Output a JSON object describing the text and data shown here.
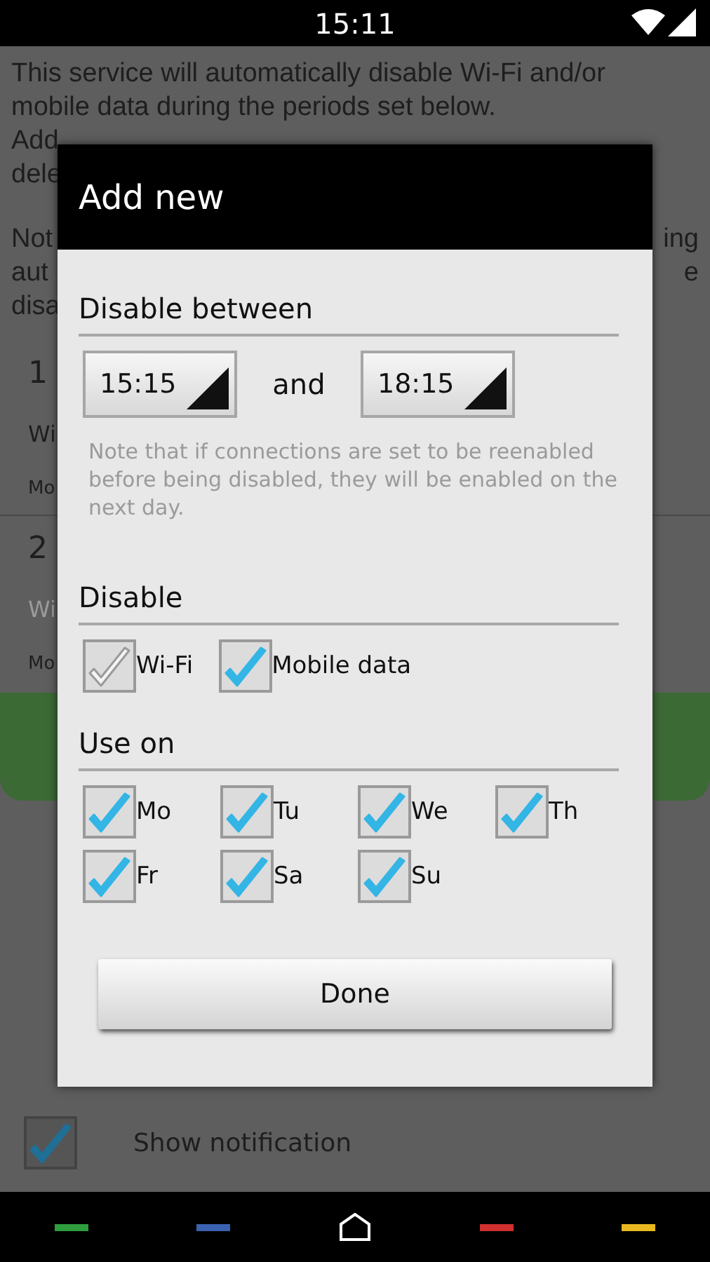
{
  "status_bar": {
    "time": "15:11"
  },
  "background": {
    "intro_lines": [
      {
        "left": "This service will automatically disable Wi-Fi and/or"
      },
      {
        "left": "mobile data during the periods set below."
      },
      {
        "left": "Add"
      },
      {
        "left": "dele"
      },
      {
        "left": "Not",
        "right": "ing"
      },
      {
        "left": "aut",
        "right": "e"
      },
      {
        "left": "disa"
      }
    ],
    "periods": [
      {
        "time": "1",
        "wifi": "Wi",
        "wifi_disabled": false,
        "days": "Mo"
      },
      {
        "time": "2",
        "wifi": "Wi",
        "wifi_disabled": true,
        "days": "Mo"
      }
    ],
    "show_notification": {
      "label": "Show notification",
      "checked": true
    }
  },
  "dialog": {
    "title": "Add new",
    "disable_between": {
      "heading": "Disable between",
      "from": "15:15",
      "joiner": "and",
      "to": "18:15",
      "note": "Note that if connections are set to be reenabled before being disabled, they will be enabled on the next day."
    },
    "disable": {
      "heading": "Disable",
      "options": [
        {
          "label": "Wi-Fi",
          "checked": false
        },
        {
          "label": "Mobile data",
          "checked": true
        }
      ]
    },
    "use_on": {
      "heading": "Use on",
      "days": [
        {
          "label": "Mo",
          "checked": true
        },
        {
          "label": "Tu",
          "checked": true
        },
        {
          "label": "We",
          "checked": true
        },
        {
          "label": "Th",
          "checked": true
        },
        {
          "label": "Fr",
          "checked": true
        },
        {
          "label": "Sa",
          "checked": true
        },
        {
          "label": "Su",
          "checked": true
        }
      ]
    },
    "done_button": "Done"
  },
  "nav_bar": {
    "dashes": [
      {
        "color": "#2e9e3e"
      },
      {
        "color": "#3a62b0"
      },
      {
        "color": "#d03030"
      },
      {
        "color": "#e8b820"
      }
    ]
  }
}
